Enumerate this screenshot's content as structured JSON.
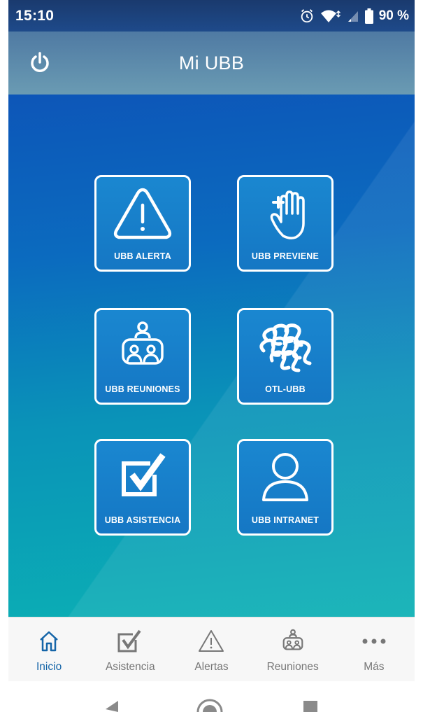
{
  "status_bar": {
    "time": "15:10",
    "battery": "90 %",
    "icons": [
      "alarm-icon",
      "wifi-icon",
      "signal-icon",
      "battery-icon"
    ]
  },
  "header": {
    "title": "Mi UBB",
    "power_icon": "power-icon"
  },
  "tiles": [
    {
      "label": "UBB ALERTA",
      "icon": "warning-triangle-icon"
    },
    {
      "label": "UBB PREVIENE",
      "icon": "hand-plus-icon"
    },
    {
      "label": "UBB REUNIONES",
      "icon": "meeting-icon"
    },
    {
      "label": "OTL-UBB",
      "icon": "otl-logo-icon"
    },
    {
      "label": "UBB ASISTENCIA",
      "icon": "checkbox-icon"
    },
    {
      "label": "UBB INTRANET",
      "icon": "user-icon"
    }
  ],
  "bottom_nav": [
    {
      "label": "Inicio",
      "icon": "home-icon",
      "active": true
    },
    {
      "label": "Asistencia",
      "icon": "checkbox-icon",
      "active": false
    },
    {
      "label": "Alertas",
      "icon": "warning-icon",
      "active": false
    },
    {
      "label": "Reuniones",
      "icon": "meeting-icon",
      "active": false
    },
    {
      "label": "Más",
      "icon": "more-icon",
      "active": false
    }
  ],
  "system_nav": [
    "back-icon",
    "home-circle-icon",
    "recents-icon"
  ],
  "colors": {
    "accent": "#1565a8",
    "tile_bg": "#1a87d0",
    "header": "#5f8fb0",
    "status_bar": "#1e4a8a"
  }
}
